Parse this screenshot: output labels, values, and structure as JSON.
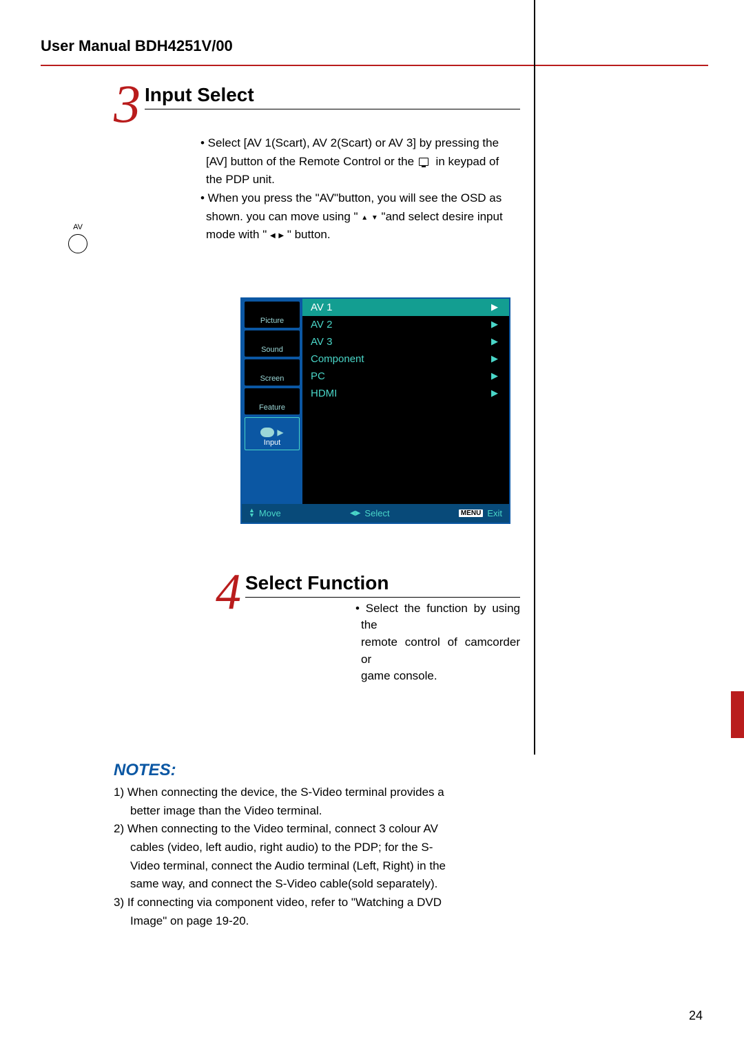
{
  "header": {
    "title": "User Manual BDH4251V/00"
  },
  "section3": {
    "number": "3",
    "title": "Input Select",
    "icon_label": "AV",
    "lines": [
      "• Select [AV 1(Scart), AV 2(Scart) or AV 3] by pressing  the",
      "[AV] button of the Remote Control or the",
      "in keypad of",
      "the PDP unit.",
      "• When you press the \"AV\"button, you will see the OSD as",
      "shown. you can move using \" ",
      " \"and select desire input",
      "mode with \" ",
      " \" button."
    ]
  },
  "osd": {
    "tabs": [
      "Picture",
      "Sound",
      "Screen",
      "Feature",
      "Input"
    ],
    "active_tab_index": 4,
    "items": [
      {
        "label": "AV 1",
        "selected": true
      },
      {
        "label": "AV 2",
        "selected": false
      },
      {
        "label": "AV 3",
        "selected": false
      },
      {
        "label": "Component",
        "selected": false
      },
      {
        "label": "PC",
        "selected": false
      },
      {
        "label": "HDMI",
        "selected": false
      }
    ],
    "footer": {
      "move": "Move",
      "select": "Select",
      "menu_badge": "MENU",
      "exit": "Exit"
    }
  },
  "section4": {
    "number": "4",
    "title": "Select Function",
    "lines": [
      "• Select the function by using the",
      "remote control of camcorder or",
      "game console."
    ]
  },
  "notes": {
    "title": "NOTES:",
    "lines": [
      "1) When connecting the device, the S-Video terminal provides a",
      "better image than the Video terminal.",
      "2) When connecting to the Video terminal, connect 3 colour AV",
      "cables (video, left audio, right audio) to the PDP; for the S-",
      "Video terminal, connect the Audio terminal (Left, Right) in the",
      "same way, and connect the S-Video cable(sold separately).",
      "3) If connecting via component video, refer to \"Watching a DVD",
      "Image\" on page 19-20."
    ]
  },
  "page_number": "24"
}
